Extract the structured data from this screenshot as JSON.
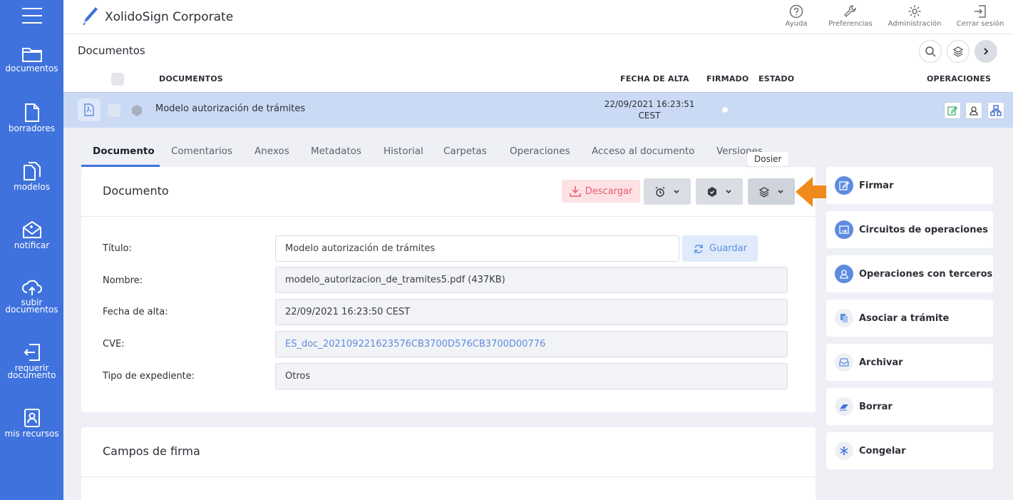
{
  "sidebar": {
    "items": [
      {
        "label": "documentos"
      },
      {
        "label": "borradores"
      },
      {
        "label": "modelos"
      },
      {
        "label": "notificar"
      },
      {
        "label": "subir",
        "label2": "documentos"
      },
      {
        "label": "requerir",
        "label2": "documento"
      },
      {
        "label": "mis recursos"
      }
    ]
  },
  "header": {
    "brand": "XolidoSign Corporate",
    "buttons": [
      "Ayuda",
      "Preferencias",
      "Administración",
      "Cerrar sesión"
    ]
  },
  "docs": {
    "title": "Documentos",
    "columns": {
      "documentos": "DOCUMENTOS",
      "fecha": "FECHA DE ALTA",
      "firmado": "FIRMADO",
      "estado": "ESTADO",
      "operaciones": "OPERACIONES"
    },
    "row": {
      "title": "Modelo autorización de trámites",
      "date": "22/09/2021 16:23:51",
      "tz": "CEST"
    }
  },
  "tabs": [
    "Documento",
    "Comentarios",
    "Anexos",
    "Metadatos",
    "Historial",
    "Carpetas",
    "Operaciones",
    "Acceso al documento",
    "Versiones"
  ],
  "tooltip": "Dosier",
  "document_card": {
    "title": "Documento",
    "download": "Descargar",
    "save": "Guardar",
    "fields": [
      {
        "label": "Título:",
        "value": "Modelo autorización de trámites"
      },
      {
        "label": "Nombre:",
        "value": "modelo_autorizacion_de_tramites5.pdf (437KB)"
      },
      {
        "label": "Fecha de alta:",
        "value": "22/09/2021 16:23:50 CEST"
      },
      {
        "label": "CVE:",
        "value": "ES_doc_202109221623576CB3700D576CB3700D00776"
      },
      {
        "label": "Tipo de expediente:",
        "value": "Otros"
      }
    ]
  },
  "signature_card": {
    "title": "Campos de firma"
  },
  "actions": [
    {
      "label": "Firmar"
    },
    {
      "label": "Circuitos de operaciones"
    },
    {
      "label": "Operaciones con terceros"
    },
    {
      "label": "Asociar a trámite"
    },
    {
      "label": "Archivar"
    },
    {
      "label": "Borrar"
    },
    {
      "label": "Congelar"
    }
  ],
  "colors": {
    "accent": "#3f72dd",
    "arrow": "#f08a1c",
    "danger": "#e75b6a"
  }
}
